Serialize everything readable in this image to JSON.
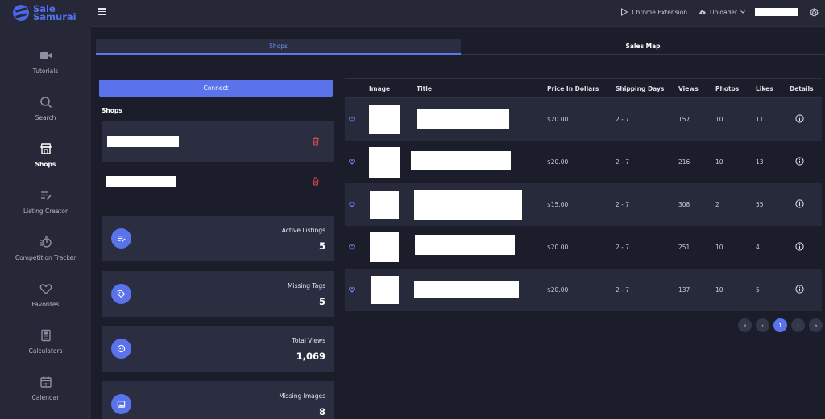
{
  "app": {
    "brand_line1": "Sale",
    "brand_line2": "Samurai"
  },
  "sidebar": {
    "items": [
      {
        "label": "Tutorials",
        "icon": "video-icon",
        "active": false
      },
      {
        "label": "Search",
        "icon": "search-icon",
        "active": false
      },
      {
        "label": "Shops",
        "icon": "store-icon",
        "active": true
      },
      {
        "label": "Listing Creator",
        "icon": "list-edit-icon",
        "active": false
      },
      {
        "label": "Competition Tracker",
        "icon": "stopwatch-icon",
        "active": false
      },
      {
        "label": "Favorites",
        "icon": "heart-icon",
        "active": false
      },
      {
        "label": "Calculators",
        "icon": "calculator-icon",
        "active": false
      },
      {
        "label": "Calendar",
        "icon": "calendar-icon",
        "active": false
      }
    ]
  },
  "topbar": {
    "chrome_extension": "Chrome Extension",
    "uploader": "Uploader"
  },
  "tabs": [
    {
      "label": "Shops",
      "active": true
    },
    {
      "label": "Sales Map",
      "active": false
    }
  ],
  "left": {
    "connect_label": "Connect",
    "shops_heading": "Shops",
    "stats": [
      {
        "label": "Active Listings",
        "value": "5",
        "icon": "list-edit-icon"
      },
      {
        "label": "Missing Tags",
        "value": "5",
        "icon": "tag-icon"
      },
      {
        "label": "Total Views",
        "value": "1,069",
        "icon": "eye-icon"
      },
      {
        "label": "Missing Images",
        "value": "8",
        "icon": "image-icon"
      }
    ]
  },
  "table": {
    "headers": [
      "Image",
      "Title",
      "Price In Dollars",
      "Shipping Days",
      "Views",
      "Photos",
      "Likes",
      "Details"
    ],
    "rows": [
      {
        "price": "$20.00",
        "shipping": "2 - 7",
        "views": "157",
        "photos": "10",
        "likes": "11"
      },
      {
        "price": "$20.00",
        "shipping": "2 - 7",
        "views": "216",
        "photos": "10",
        "likes": "13"
      },
      {
        "price": "$15.00",
        "shipping": "2 - 7",
        "views": "308",
        "photos": "2",
        "likes": "55"
      },
      {
        "price": "$20.00",
        "shipping": "2 - 7",
        "views": "251",
        "photos": "10",
        "likes": "4"
      },
      {
        "price": "$20.00",
        "shipping": "2 - 7",
        "views": "137",
        "photos": "10",
        "likes": "5"
      }
    ]
  },
  "pagination": {
    "first": "«",
    "prev": "‹",
    "current": "1",
    "next": "›",
    "last": "»"
  },
  "colors": {
    "accent": "#5a73ea",
    "background": "#1b1d2a",
    "panel": "#262838",
    "danger": "#e04b4b"
  }
}
